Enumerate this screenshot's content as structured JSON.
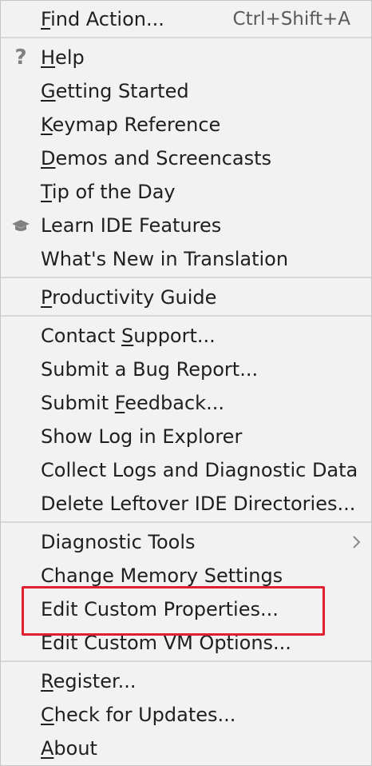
{
  "menu": {
    "find_action": {
      "pre": "",
      "mn": "F",
      "post": "ind Action...",
      "shortcut": "Ctrl+Shift+A"
    },
    "help": {
      "pre": "",
      "mn": "H",
      "post": "elp",
      "icon": "question-icon"
    },
    "getting_started": {
      "pre": "",
      "mn": "G",
      "post": "etting Started"
    },
    "keymap_reference": {
      "pre": "",
      "mn": "K",
      "post": "eymap Reference"
    },
    "demos": {
      "pre": "",
      "mn": "D",
      "post": "emos and Screencasts"
    },
    "tip": {
      "pre": "",
      "mn": "T",
      "post": "ip of the Day"
    },
    "learn": {
      "text": "Learn IDE Features",
      "icon": "graduation-cap-icon"
    },
    "whats_new": {
      "text": "What's New in Translation"
    },
    "productivity": {
      "pre": "",
      "mn": "P",
      "post": "roductivity Guide"
    },
    "contact_support": {
      "pre": "Contact ",
      "mn": "S",
      "post": "upport..."
    },
    "submit_bug": {
      "text": "Submit a Bug Report..."
    },
    "submit_feedback": {
      "pre": "Submit ",
      "mn": "F",
      "post": "eedback..."
    },
    "show_log": {
      "text": "Show Log in Explorer"
    },
    "collect_logs": {
      "text": "Collect Logs and Diagnostic Data"
    },
    "delete_leftover": {
      "text": "Delete Leftover IDE Directories..."
    },
    "diagnostic_tools": {
      "text": "Diagnostic Tools",
      "icon": "chevron-right-icon"
    },
    "change_memory": {
      "text": "Change Memory Settings"
    },
    "edit_custom_properties": {
      "text": "Edit Custom Properties..."
    },
    "edit_custom_vm": {
      "text": "Edit Custom VM Options..."
    },
    "register": {
      "pre": "",
      "mn": "R",
      "post": "egister..."
    },
    "check_updates": {
      "pre": "",
      "mn": "C",
      "post": "heck for Updates..."
    },
    "about": {
      "pre": "",
      "mn": "A",
      "post": "bout"
    }
  },
  "colors": {
    "background": "#f2f2f2",
    "separator": "#d8d8d8",
    "highlight_border": "#e0202e",
    "text": "#1f1f1f"
  }
}
